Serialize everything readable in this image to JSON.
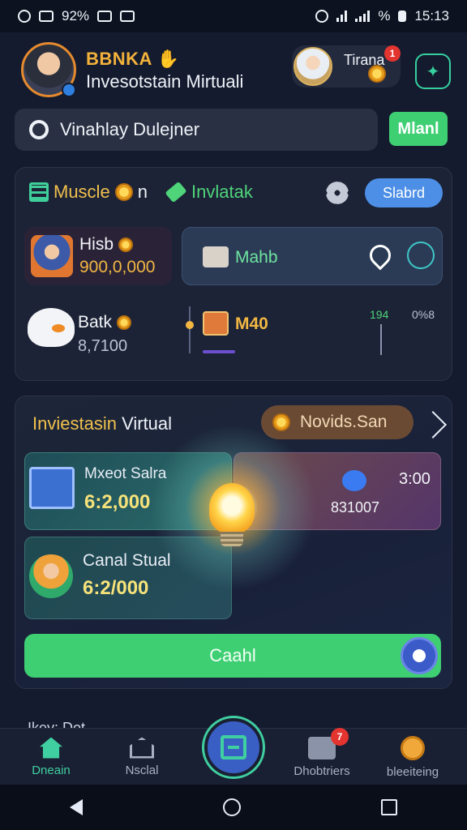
{
  "status_bar": {
    "battery_left": "92%",
    "battery_right": "%",
    "time": "15:13"
  },
  "header": {
    "brand": "BBNKA",
    "subtitle": "Invesotstain Mirtuali",
    "friend_name": "Tirana",
    "notification_count": "1"
  },
  "search": {
    "text": "Vinahlay Dulejner",
    "button_label": "Mlanl"
  },
  "panel_top": {
    "tab_muscle": "Muscle",
    "tab_muscle_suffix": "n",
    "tab_invest": "Invlatak",
    "pill_label": "Slabrd",
    "card1_name": "Hisb",
    "card1_amount": "900,0,000",
    "card2_label": "Mahb",
    "card3_name": "Batk",
    "card3_amount": "8,7100",
    "card4_label": "M40",
    "stat_a": "194",
    "stat_b": "0%8"
  },
  "virtual": {
    "title_part1": "Inviestasin",
    "title_part2": "Virtual",
    "bonus_label": "Novids.San",
    "tile1_title": "Mxeot Salra",
    "tile1_amount": "6:2,000",
    "tile2_value": "3:00",
    "tile2_amount": "831007",
    "tile3_title": "Canal Stual",
    "tile3_amount": "6:2/000",
    "cash_button": "Caahl"
  },
  "section_peek": "Ikey: Dot",
  "bottom_nav": {
    "home": "Dneain",
    "social": "Nsclal",
    "notifications": "Dhobtriers",
    "notification_count": "7",
    "settings": "bleeiteing"
  },
  "colors": {
    "accent_green": "#3fcf73",
    "gold": "#f2b743",
    "brand_orange": "#e68a2e",
    "bg": "#141b2e"
  }
}
